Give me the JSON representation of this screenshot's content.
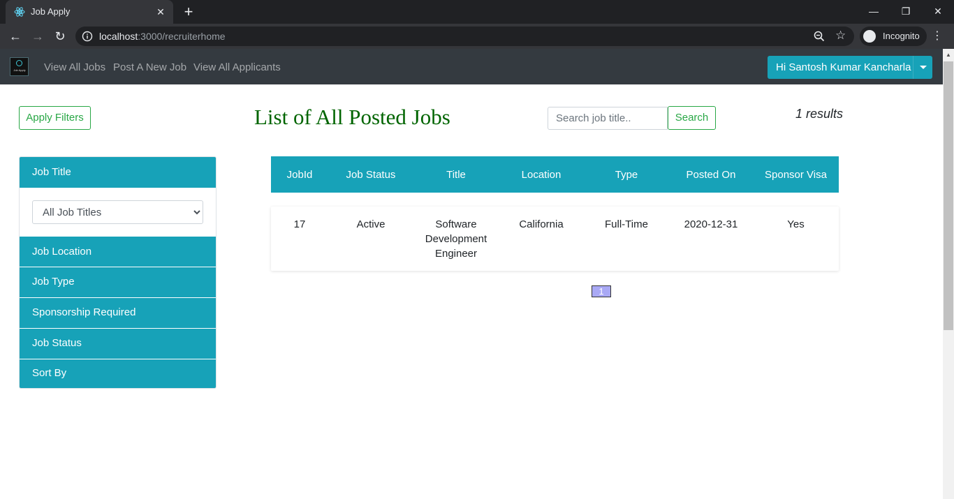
{
  "browser": {
    "tab_title": "Job Apply",
    "url_host": "localhost",
    "url_rest": ":3000/recruiterhome",
    "profile_label": "Incognito"
  },
  "navbar": {
    "links": [
      "View All Jobs",
      "Post A New Job",
      "View All Applicants"
    ],
    "user_greeting": "Hi Santosh Kumar Kancharla",
    "logo_text": "Job Apply"
  },
  "page": {
    "apply_filters_label": "Apply Filters",
    "title": "List of All Posted Jobs",
    "search_placeholder": "Search job title..",
    "search_button_label": "Search",
    "results_text": "1 results"
  },
  "filters": {
    "sections": [
      "Job Title",
      "Job Location",
      "Job Type",
      "Sponsorship Required",
      "Job Status",
      "Sort By"
    ],
    "job_title_selected": "All Job Titles"
  },
  "table": {
    "columns": [
      "JobId",
      "Job Status",
      "Title",
      "Location",
      "Type",
      "Posted On",
      "Sponsor Visa"
    ],
    "rows": [
      {
        "job_id": "17",
        "status": "Active",
        "title_lines": [
          "Software",
          "Development",
          "Engineer"
        ],
        "location": "California",
        "type": "Full-Time",
        "posted_on": "2020-12-31",
        "sponsor_visa": "Yes"
      }
    ]
  },
  "pagination": {
    "current_page": "1"
  },
  "colors": {
    "accent": "#17a2b8",
    "success": "#28a745",
    "title_green": "#006400",
    "navbar_bg": "#343a40"
  },
  "icons": {
    "favicon": "react-icon",
    "info": "info-icon",
    "zoom": "zoom-icon",
    "bookmark": "star-icon",
    "incognito": "incognito-icon"
  }
}
